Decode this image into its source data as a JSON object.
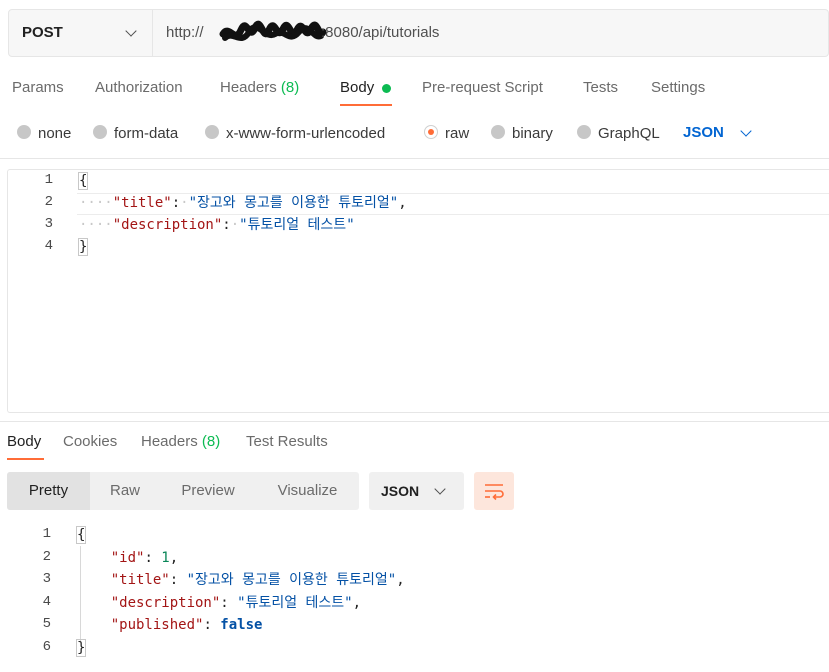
{
  "request": {
    "method": "POST",
    "url_prefix": "http://",
    "url_suffix": ":8080/api/tutorials"
  },
  "tabs": [
    {
      "label": "Params"
    },
    {
      "label": "Authorization"
    },
    {
      "label": "Headers",
      "count": "(8)"
    },
    {
      "label": "Body"
    },
    {
      "label": "Pre-request Script"
    },
    {
      "label": "Tests"
    },
    {
      "label": "Settings"
    }
  ],
  "body_types": [
    "none",
    "form-data",
    "x-www-form-urlencoded",
    "raw",
    "binary",
    "GraphQL"
  ],
  "body_selected": "raw",
  "body_format": "JSON",
  "request_body_lines": [
    "1",
    "2",
    "3",
    "4"
  ],
  "request_body": {
    "open": "{",
    "line2_key": "\"title\"",
    "line2_value": "\"장고와 몽고를 이용한 튜토리얼\"",
    "line3_key": "\"description\"",
    "line3_value": "\"튜토리얼 테스트\"",
    "close": "}"
  },
  "response_tabs": [
    {
      "label": "Body"
    },
    {
      "label": "Cookies"
    },
    {
      "label": "Headers",
      "count": "(8)"
    },
    {
      "label": "Test Results"
    }
  ],
  "view_modes": [
    "Pretty",
    "Raw",
    "Preview",
    "Visualize"
  ],
  "response_format": "JSON",
  "response_lines": [
    "1",
    "2",
    "3",
    "4",
    "5",
    "6"
  ],
  "response_body": {
    "open": "{",
    "id_key": "\"id\"",
    "id_value": "1",
    "title_key": "\"title\"",
    "title_value": "\"장고와 몽고를 이용한 튜토리얼\"",
    "description_key": "\"description\"",
    "description_value": "\"튜토리얼 테스트\"",
    "published_key": "\"published\"",
    "published_value": "false",
    "close": "}"
  },
  "colors": {
    "accent": "#ff6c37",
    "count_green": "#0cbb52",
    "link_blue": "#0265d2"
  }
}
